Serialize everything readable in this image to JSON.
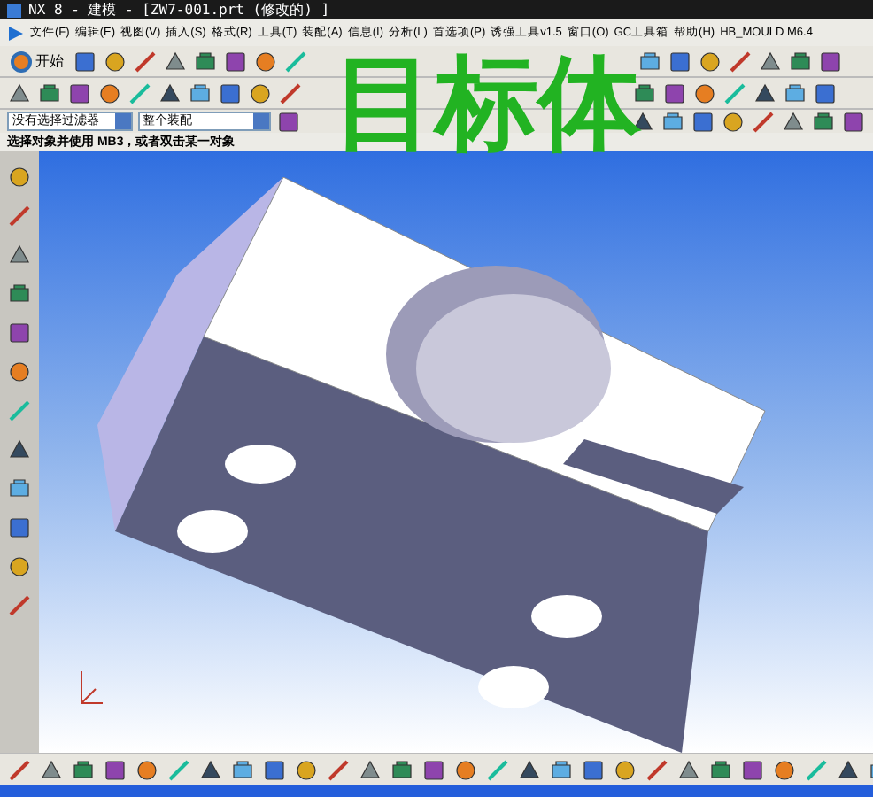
{
  "window": {
    "title": "NX 8 - 建模 - [ZW7-001.prt (修改的) ]"
  },
  "menu": [
    {
      "label": "文件(F)"
    },
    {
      "label": "编辑(E)"
    },
    {
      "label": "视图(V)"
    },
    {
      "label": "插入(S)"
    },
    {
      "label": "格式(R)"
    },
    {
      "label": "工具(T)"
    },
    {
      "label": "装配(A)"
    },
    {
      "label": "信息(I)"
    },
    {
      "label": "分析(L)"
    },
    {
      "label": "首选项(P)"
    },
    {
      "label": "诱强工具v1.5"
    },
    {
      "label": "窗口(O)"
    },
    {
      "label": "GC工具箱"
    },
    {
      "label": "帮助(H)"
    },
    {
      "label": "HB_MOULD M6.4"
    }
  ],
  "start_button": {
    "label": "开始"
  },
  "selection_bar": {
    "type_filter": "没有选择过滤器",
    "scope": "整个装配"
  },
  "status": "选择对象并使用 MB3，或者双击某一对象",
  "annotation": "目标体"
}
